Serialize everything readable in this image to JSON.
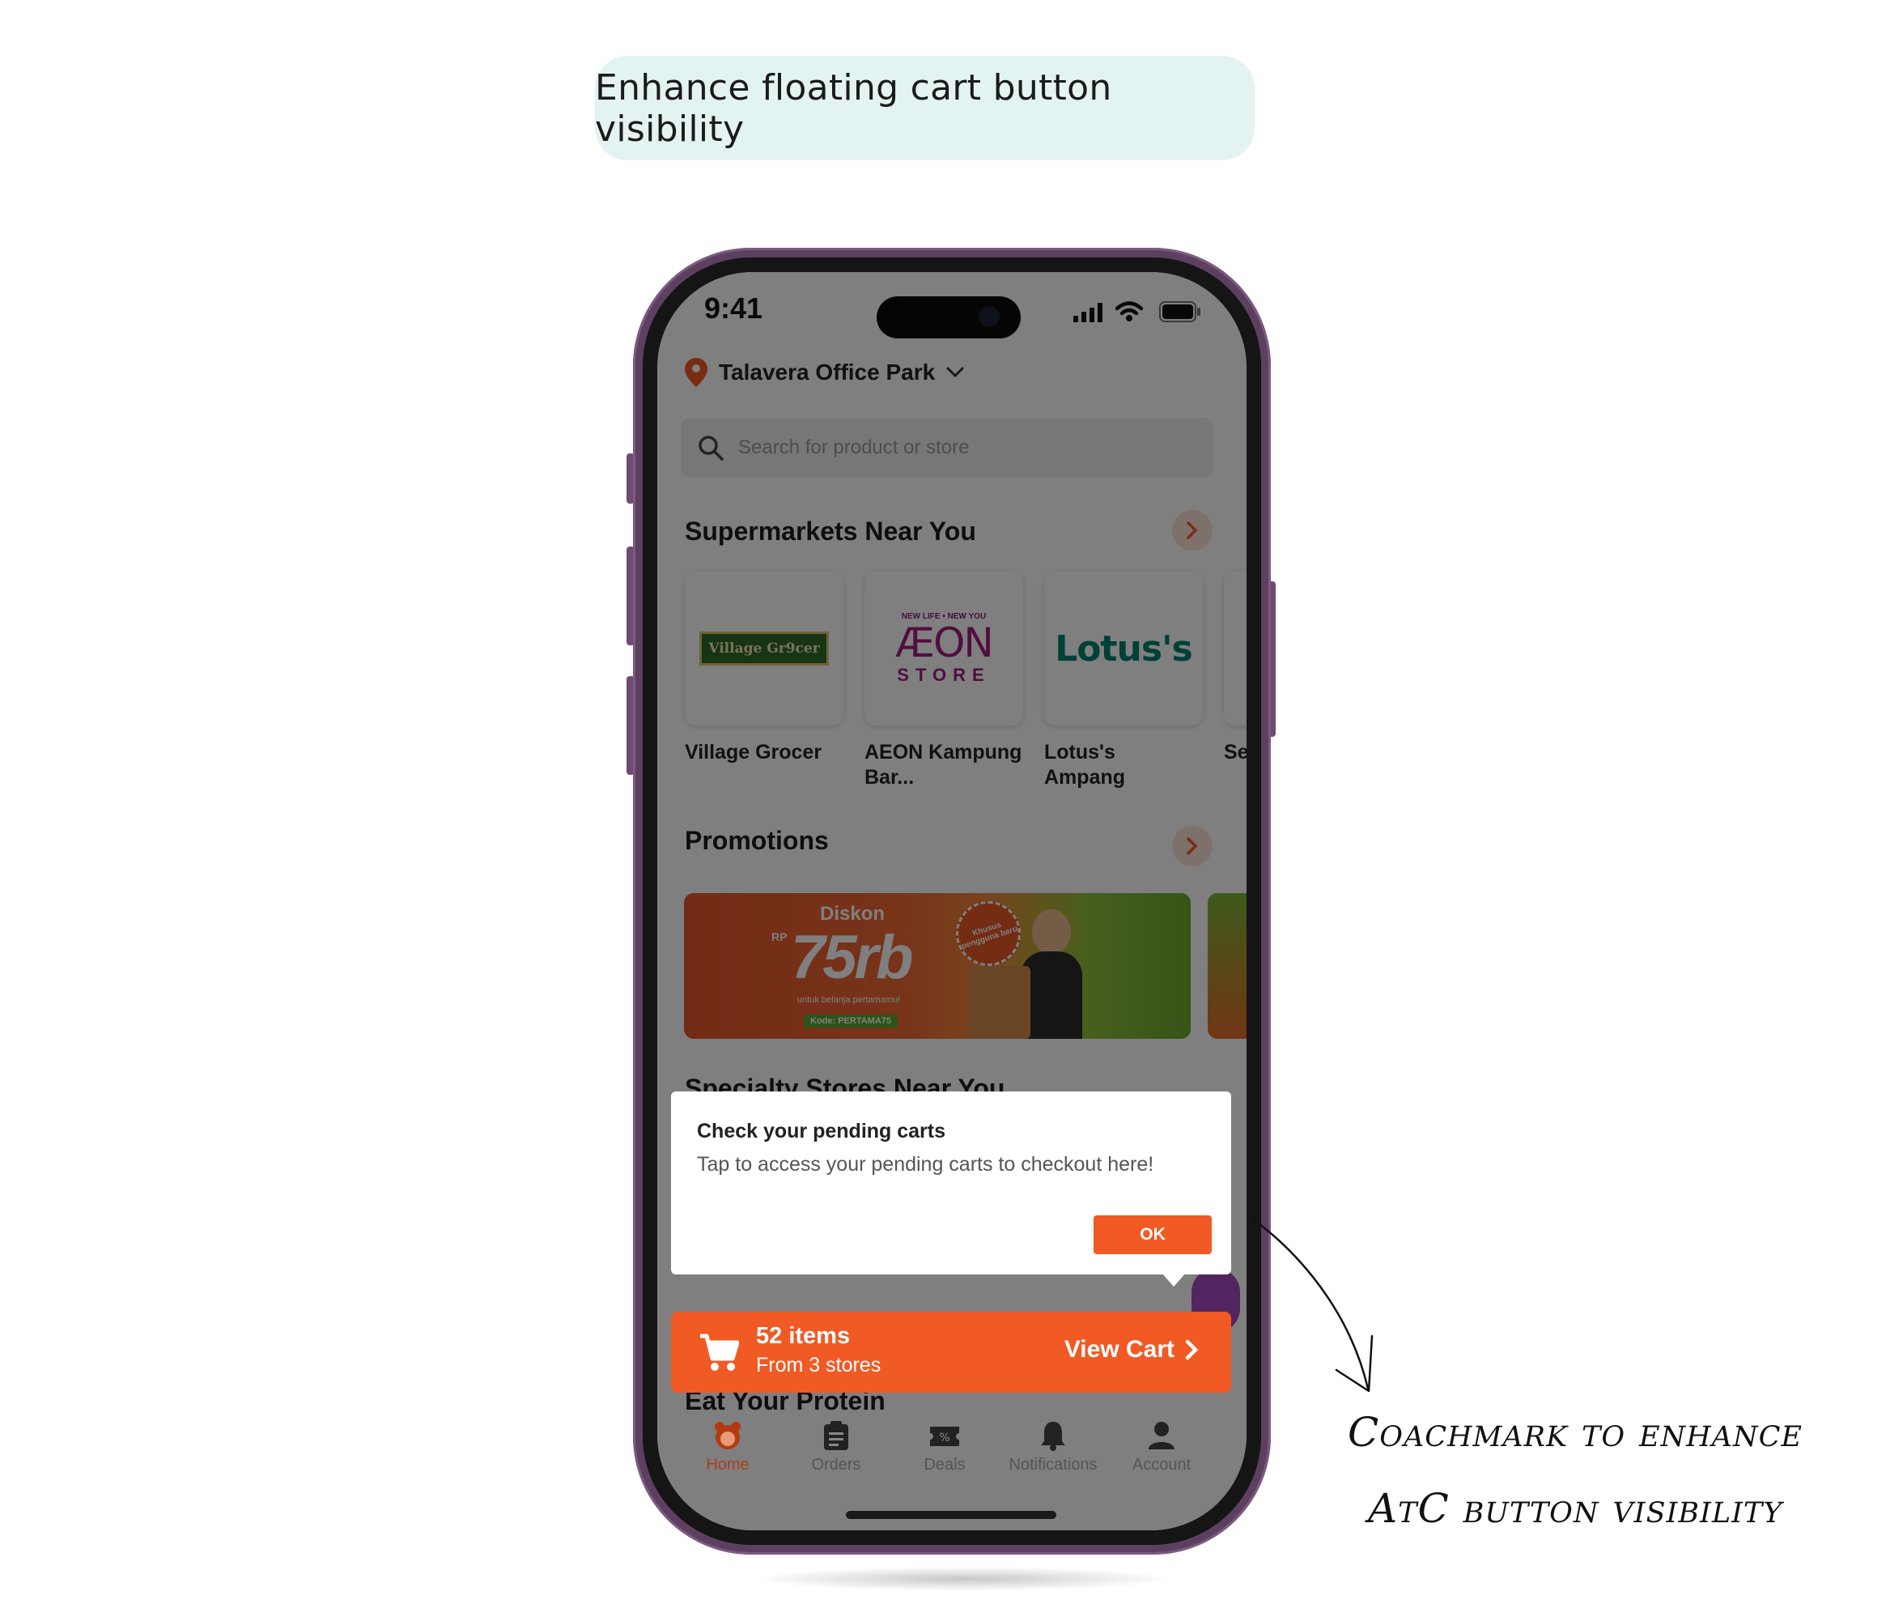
{
  "header_label": "Enhance floating cart button visibility",
  "status_bar": {
    "time": "9:41"
  },
  "location": {
    "name": "Talavera Office Park"
  },
  "search": {
    "placeholder": "Search for product or store"
  },
  "supermarkets": {
    "title": "Supermarkets Near You",
    "stores": [
      {
        "name": "Village Grocer",
        "logo_text": "Village Gr9cer"
      },
      {
        "name": "AEON Kampung Bar...",
        "logo_text": "ÆON",
        "logo_tagline": "NEW LIFE • NEW YOU",
        "logo_sub": "STORE"
      },
      {
        "name": "Lotus's Ampang",
        "logo_text": "Lotus's"
      },
      {
        "name": "Se"
      }
    ]
  },
  "promotions": {
    "title": "Promotions",
    "banner": {
      "headline": "Diskon",
      "currency": "RP",
      "amount": "75rb",
      "subtext": "untuk belanja pertamamu!",
      "code_label": "Kode: PERTAMA75",
      "badge": "Khusus pengguna baru"
    }
  },
  "hidden_sections": {
    "specialty": "Specialty Stores Near You",
    "protein": "Eat Your Protein"
  },
  "coachmark": {
    "title": "Check your pending carts",
    "body": "Tap to access your pending carts to checkout here!",
    "ok_label": "OK"
  },
  "cart": {
    "items": "52 items",
    "stores": "From 3 stores",
    "cta": "View Cart"
  },
  "tabs": [
    {
      "label": "Home",
      "icon": "home-mascot-icon",
      "active": true
    },
    {
      "label": "Orders",
      "icon": "clipboard-icon"
    },
    {
      "label": "Deals",
      "icon": "ticket-percent-icon"
    },
    {
      "label": "Notifications",
      "icon": "bell-icon"
    },
    {
      "label": "Account",
      "icon": "person-icon"
    }
  ],
  "annotation": {
    "line1": "Coachmark to enhance",
    "line2": "AtC button visibility"
  },
  "colors": {
    "accent": "#f15a24",
    "pill_bg": "#e3f3f2",
    "phone_frame": "#5d3f5f"
  }
}
